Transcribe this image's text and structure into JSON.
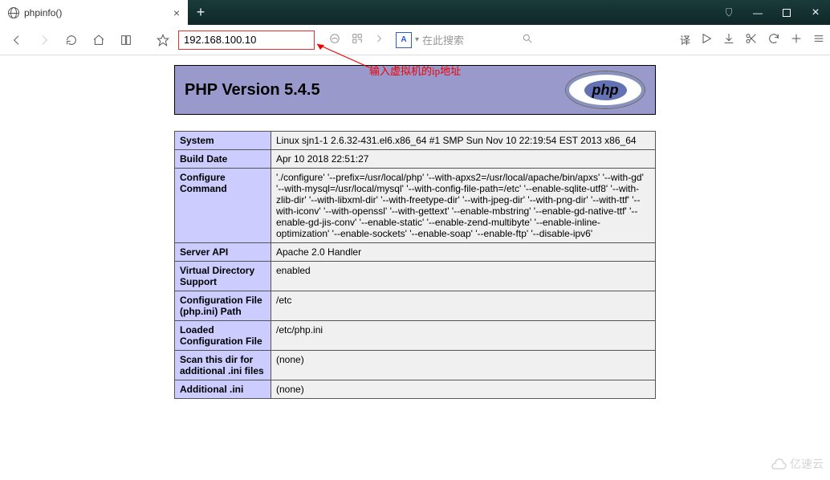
{
  "tab": {
    "title": "phpinfo()"
  },
  "address": {
    "value": "192.168.100.10"
  },
  "search": {
    "placeholder": "在此搜索",
    "engine_label": "A"
  },
  "annotation": {
    "text": "输入虚拟机的ip地址"
  },
  "toolbar_icons": {
    "translate_label": "译"
  },
  "php": {
    "title": "PHP Version 5.4.5",
    "logo_text": "php",
    "rows": [
      {
        "k": "System",
        "v": "Linux sjn1-1 2.6.32-431.el6.x86_64 #1 SMP Sun Nov 10 22:19:54 EST 2013 x86_64"
      },
      {
        "k": "Build Date",
        "v": "Apr 10 2018 22:51:27"
      },
      {
        "k": "Configure Command",
        "v": "'./configure' '--prefix=/usr/local/php' '--with-apxs2=/usr/local/apache/bin/apxs' '--with-gd' '--with-mysql=/usr/local/mysql' '--with-config-file-path=/etc' '--enable-sqlite-utf8' '--with-zlib-dir' '--with-libxml-dir' '--with-freetype-dir' '--with-jpeg-dir' '--with-png-dir' '--with-ttf' '--with-iconv' '--with-openssl' '--with-gettext' '--enable-mbstring' '--enable-gd-native-ttf' '--enable-gd-jis-conv' '--enable-static' '--enable-zend-multibyte' '--enable-inline-optimization' '--enable-sockets' '--enable-soap' '--enable-ftp' '--disable-ipv6'"
      },
      {
        "k": "Server API",
        "v": "Apache 2.0 Handler"
      },
      {
        "k": "Virtual Directory Support",
        "v": "enabled"
      },
      {
        "k": "Configuration File (php.ini) Path",
        "v": "/etc"
      },
      {
        "k": "Loaded Configuration File",
        "v": "/etc/php.ini"
      },
      {
        "k": "Scan this dir for additional .ini files",
        "v": "(none)"
      },
      {
        "k": "Additional .ini",
        "v": "(none)"
      }
    ]
  },
  "watermark": {
    "text": "亿速云"
  }
}
